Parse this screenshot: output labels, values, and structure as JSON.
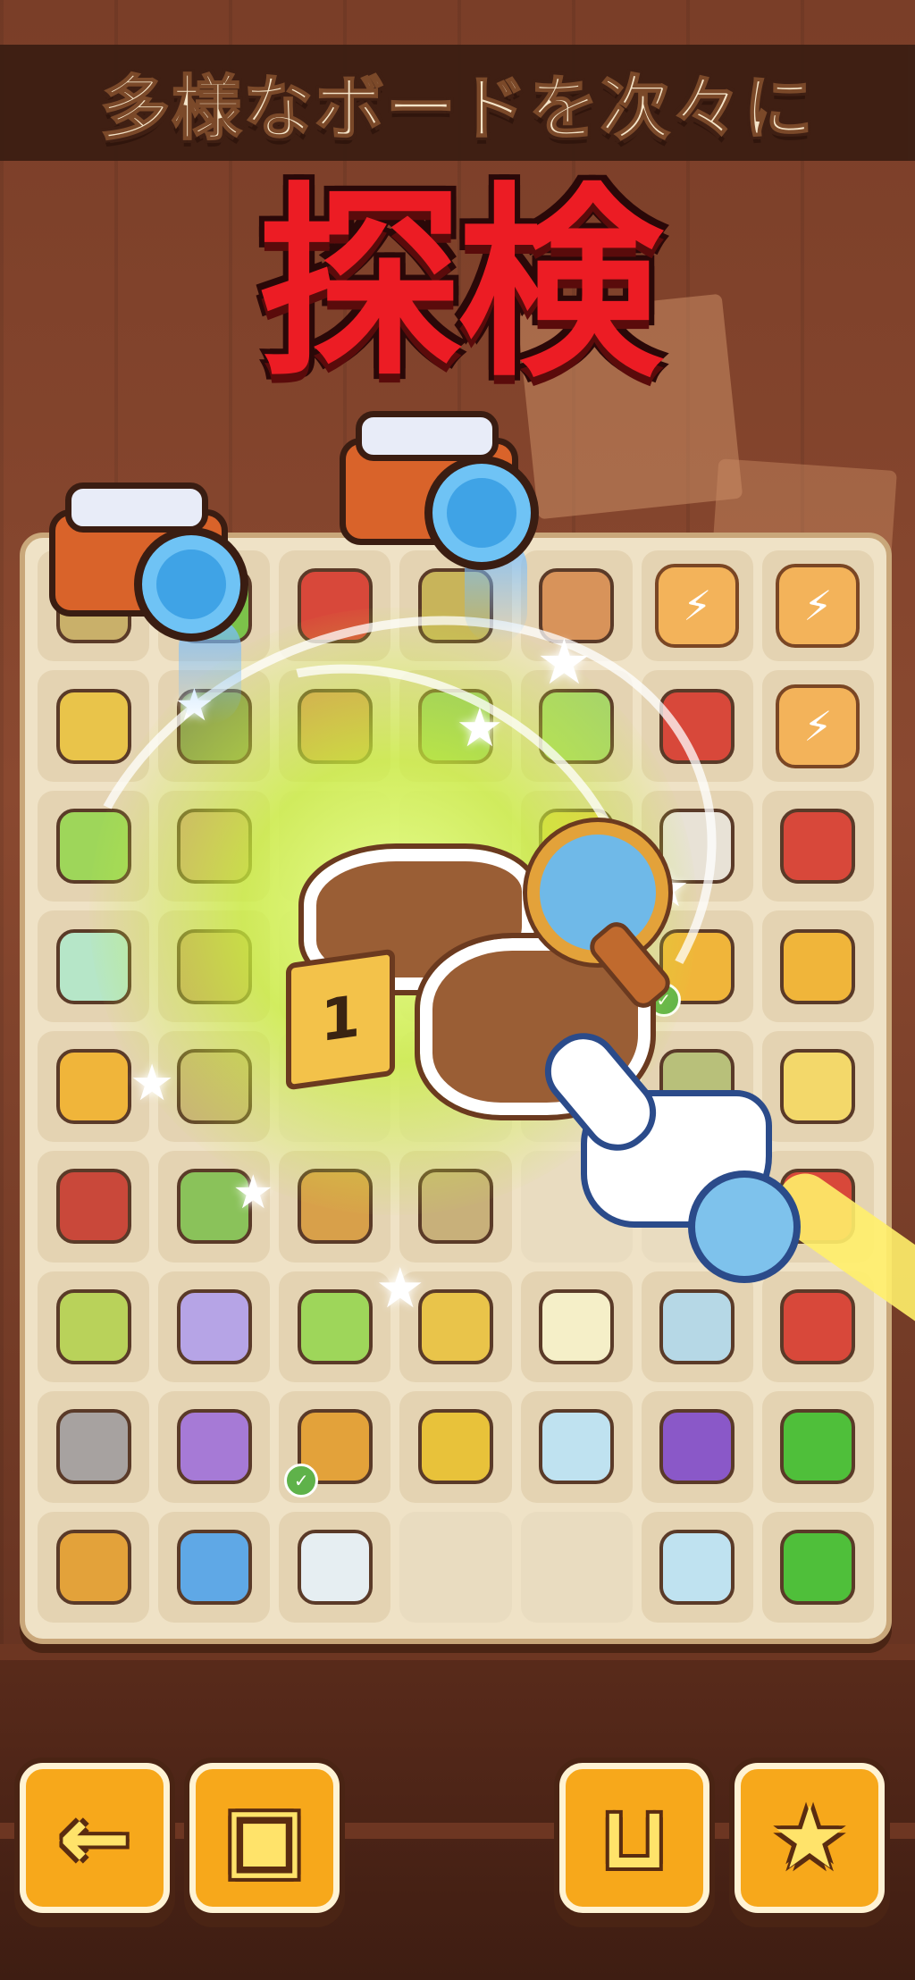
{
  "header": {
    "banner_text": "多様なボードを次々に",
    "title": "探検"
  },
  "colors": {
    "title_red": "#ec1c24",
    "banner_bg": "#3a1d12",
    "board_bg": "#efe2c6",
    "button_orange": "#f7a81b",
    "glow_green": "#c8f03c"
  },
  "board": {
    "rows": [
      [
        "lamp-item",
        "plant-pot-icon",
        "tools-item",
        "boots-item",
        "box-item",
        "lightning-box-icon",
        "lightning-box-icon"
      ],
      [
        "barrier-crate-icon",
        "junk-pile-icon",
        "box-item",
        "radio-item",
        "plants-item",
        "toolbox-red-icon",
        "lightning-box-icon"
      ],
      [
        "green-gem-box-icon",
        "cloth-item",
        "",
        "",
        "ring-item",
        "toolbox-open-icon",
        "toolbox-red-icon"
      ],
      [
        "mint-lamp-icon",
        "bear-item",
        "",
        "",
        "",
        "barrier-sign-icon",
        "barrier-sign-icon"
      ],
      [
        "barrier-sign-icon",
        "cup-item",
        "",
        "",
        "",
        "bowl-item",
        "ring-water-icon"
      ],
      [
        "axe-icon",
        "green-item",
        "tube-item",
        "frame-item",
        "",
        "",
        "toolbox-red-icon"
      ],
      [
        "green-bag-icon",
        "street-lamp-icon",
        "sprout-icon",
        "barrier-crate-icon",
        "globe-lamp-icon",
        "trophy-star-icon",
        "motor-icon"
      ],
      [
        "stone-machine-icon",
        "purple-lamp-icon",
        "magnifier-icon",
        "gold-bag-icon",
        "glass-trophy-icon",
        "purple-scooter-icon",
        "green-sponge-icon"
      ],
      [
        "magnifier-icon",
        "blue-magnifier-icon",
        "light-bulb-icon",
        "",
        "",
        "glass-trophy-icon",
        "green-cloth-icon"
      ]
    ],
    "checked_cells": [
      "3-5",
      "7-2"
    ]
  },
  "clue": {
    "marker_number": "1"
  },
  "buttons": [
    {
      "name": "back-button",
      "icon": "arrow-left-icon"
    },
    {
      "name": "box-button",
      "icon": "box-icon"
    },
    {
      "name": "basket-button",
      "icon": "basket-icon"
    },
    {
      "name": "star-button",
      "icon": "star-icon"
    }
  ]
}
